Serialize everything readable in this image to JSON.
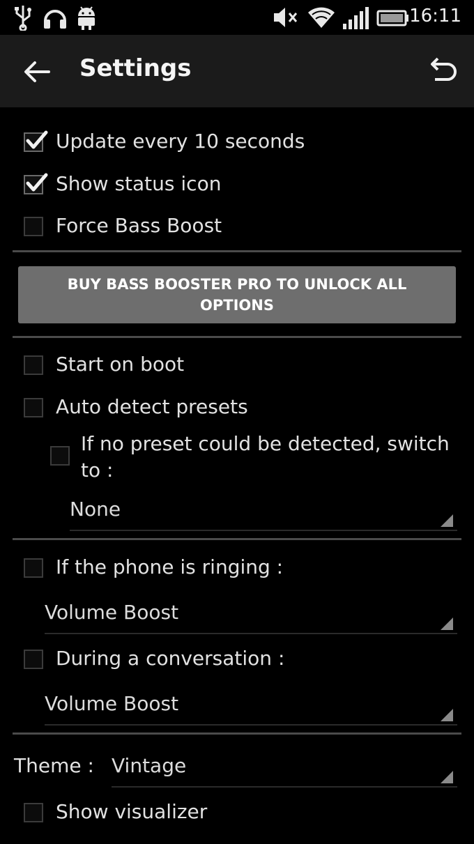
{
  "status_bar": {
    "time": "16:11",
    "icons": [
      "usb-icon",
      "headphones-icon",
      "android-icon",
      "mute-icon",
      "wifi-icon",
      "signal-icon",
      "battery-icon"
    ]
  },
  "app_bar": {
    "title": "Settings",
    "back_icon": "arrow-back-icon",
    "undo_icon": "undo-icon"
  },
  "options": {
    "update_every": {
      "label": "Update every 10 seconds",
      "checked": true
    },
    "show_status_icon": {
      "label": "Show status icon",
      "checked": true
    },
    "force_bass_boost": {
      "label": "Force Bass Boost",
      "checked": false
    },
    "start_on_boot": {
      "label": "Start on boot",
      "checked": false
    },
    "auto_detect_presets": {
      "label": "Auto detect presets",
      "checked": false
    },
    "no_preset_switch": {
      "label_line1": "If no preset could be detected, switch",
      "label_line2": "to :",
      "checked": false,
      "value": "None"
    },
    "phone_ringing": {
      "label": "If the phone is ringing :",
      "checked": false,
      "value": "Volume Boost"
    },
    "conversation": {
      "label": "During a conversation :",
      "checked": false,
      "value": "Volume Boost"
    },
    "theme": {
      "label": "Theme :",
      "value": "Vintage"
    },
    "show_visualizer": {
      "label": "Show visualizer",
      "checked": false
    }
  },
  "pro_button": {
    "label": "BUY BASS BOOSTER PRO TO UNLOCK ALL OPTIONS"
  },
  "colors": {
    "app_bar_bg": "#1b1b1b",
    "background": "#000000",
    "pro_button_bg": "#6e6e6e",
    "divider": "#4b4b4b"
  }
}
